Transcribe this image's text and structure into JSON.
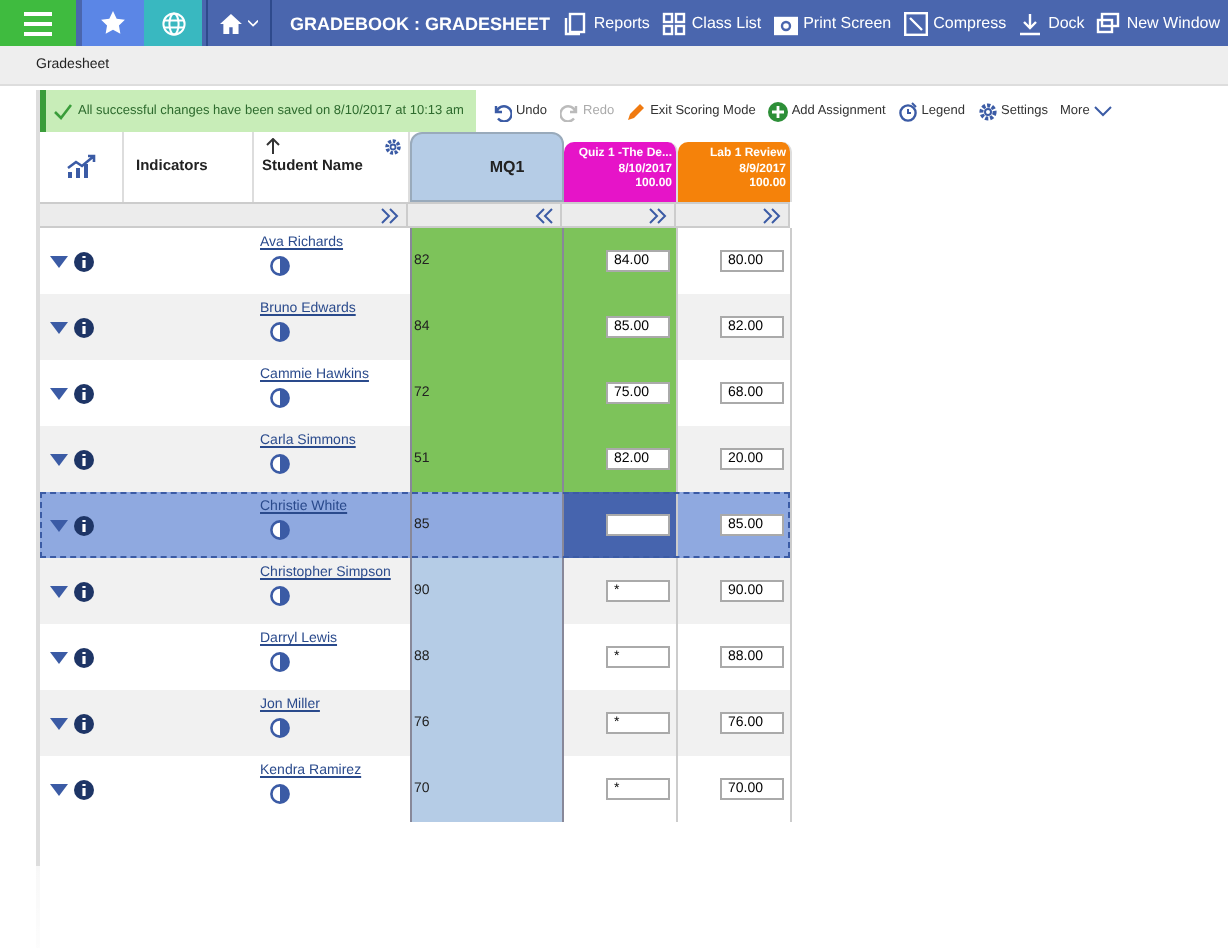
{
  "topbar": {
    "title": "GRADEBOOK : GRADESHEET",
    "actions": [
      "Reports",
      "Class List",
      "Print Screen",
      "Compress",
      "Dock",
      "New Window"
    ]
  },
  "breadcrumb": "Gradesheet",
  "message": "All successful changes have been saved on 8/10/2017 at 10:13 am",
  "toolbar": [
    {
      "kind": "undo",
      "label": "Undo",
      "disabled": false
    },
    {
      "kind": "redo",
      "label": "Redo",
      "disabled": true
    },
    {
      "kind": "pencil",
      "label": "Exit Scoring Mode",
      "disabled": false
    },
    {
      "kind": "plus",
      "label": "Add Assignment",
      "disabled": false
    },
    {
      "kind": "legend",
      "label": "Legend",
      "disabled": false
    },
    {
      "kind": "gear",
      "label": "Settings",
      "disabled": false
    },
    {
      "kind": "more",
      "label": "More",
      "disabled": false
    }
  ],
  "columns": {
    "indicators": "Indicators",
    "student": "Student Name",
    "term": "MQ1"
  },
  "assignments": [
    {
      "title": "Quiz 1 -The De...",
      "date": "8/10/2017",
      "points": "100.00",
      "color": "#e614c8"
    },
    {
      "title": "Lab 1 Review",
      "date": "8/9/2017",
      "points": "100.00",
      "color": "#f5820a"
    }
  ],
  "rows": [
    {
      "name": "Ava Richards",
      "term": "82",
      "quiz": "84.00",
      "lab": "80.00",
      "selected": false,
      "color": "#7dc35a"
    },
    {
      "name": "Bruno Edwards",
      "term": "84",
      "quiz": "85.00",
      "lab": "82.00",
      "selected": false,
      "color": "#7dc35a"
    },
    {
      "name": "Cammie Hawkins",
      "term": "72",
      "quiz": "75.00",
      "lab": "68.00",
      "selected": false,
      "color": "#7dc35a"
    },
    {
      "name": "Carla Simmons",
      "term": "51",
      "quiz": "82.00",
      "lab": "20.00",
      "selected": false,
      "color": "#7dc35a"
    },
    {
      "name": "Christie White",
      "term": "85",
      "lab": "85.00",
      "selected": true
    },
    {
      "name": "Christopher Simpson",
      "term": "90",
      "quiz": "*",
      "lab": "90.00",
      "selected": false
    },
    {
      "name": "Darryl Lewis",
      "term": "88",
      "quiz": "*",
      "lab": "88.00",
      "selected": false
    },
    {
      "name": "Jon Miller",
      "term": "76",
      "quiz": "*",
      "lab": "76.00",
      "selected": false
    },
    {
      "name": "Kendra Ramirez",
      "term": "70",
      "quiz": "*",
      "lab": "70.00",
      "selected": false
    }
  ]
}
